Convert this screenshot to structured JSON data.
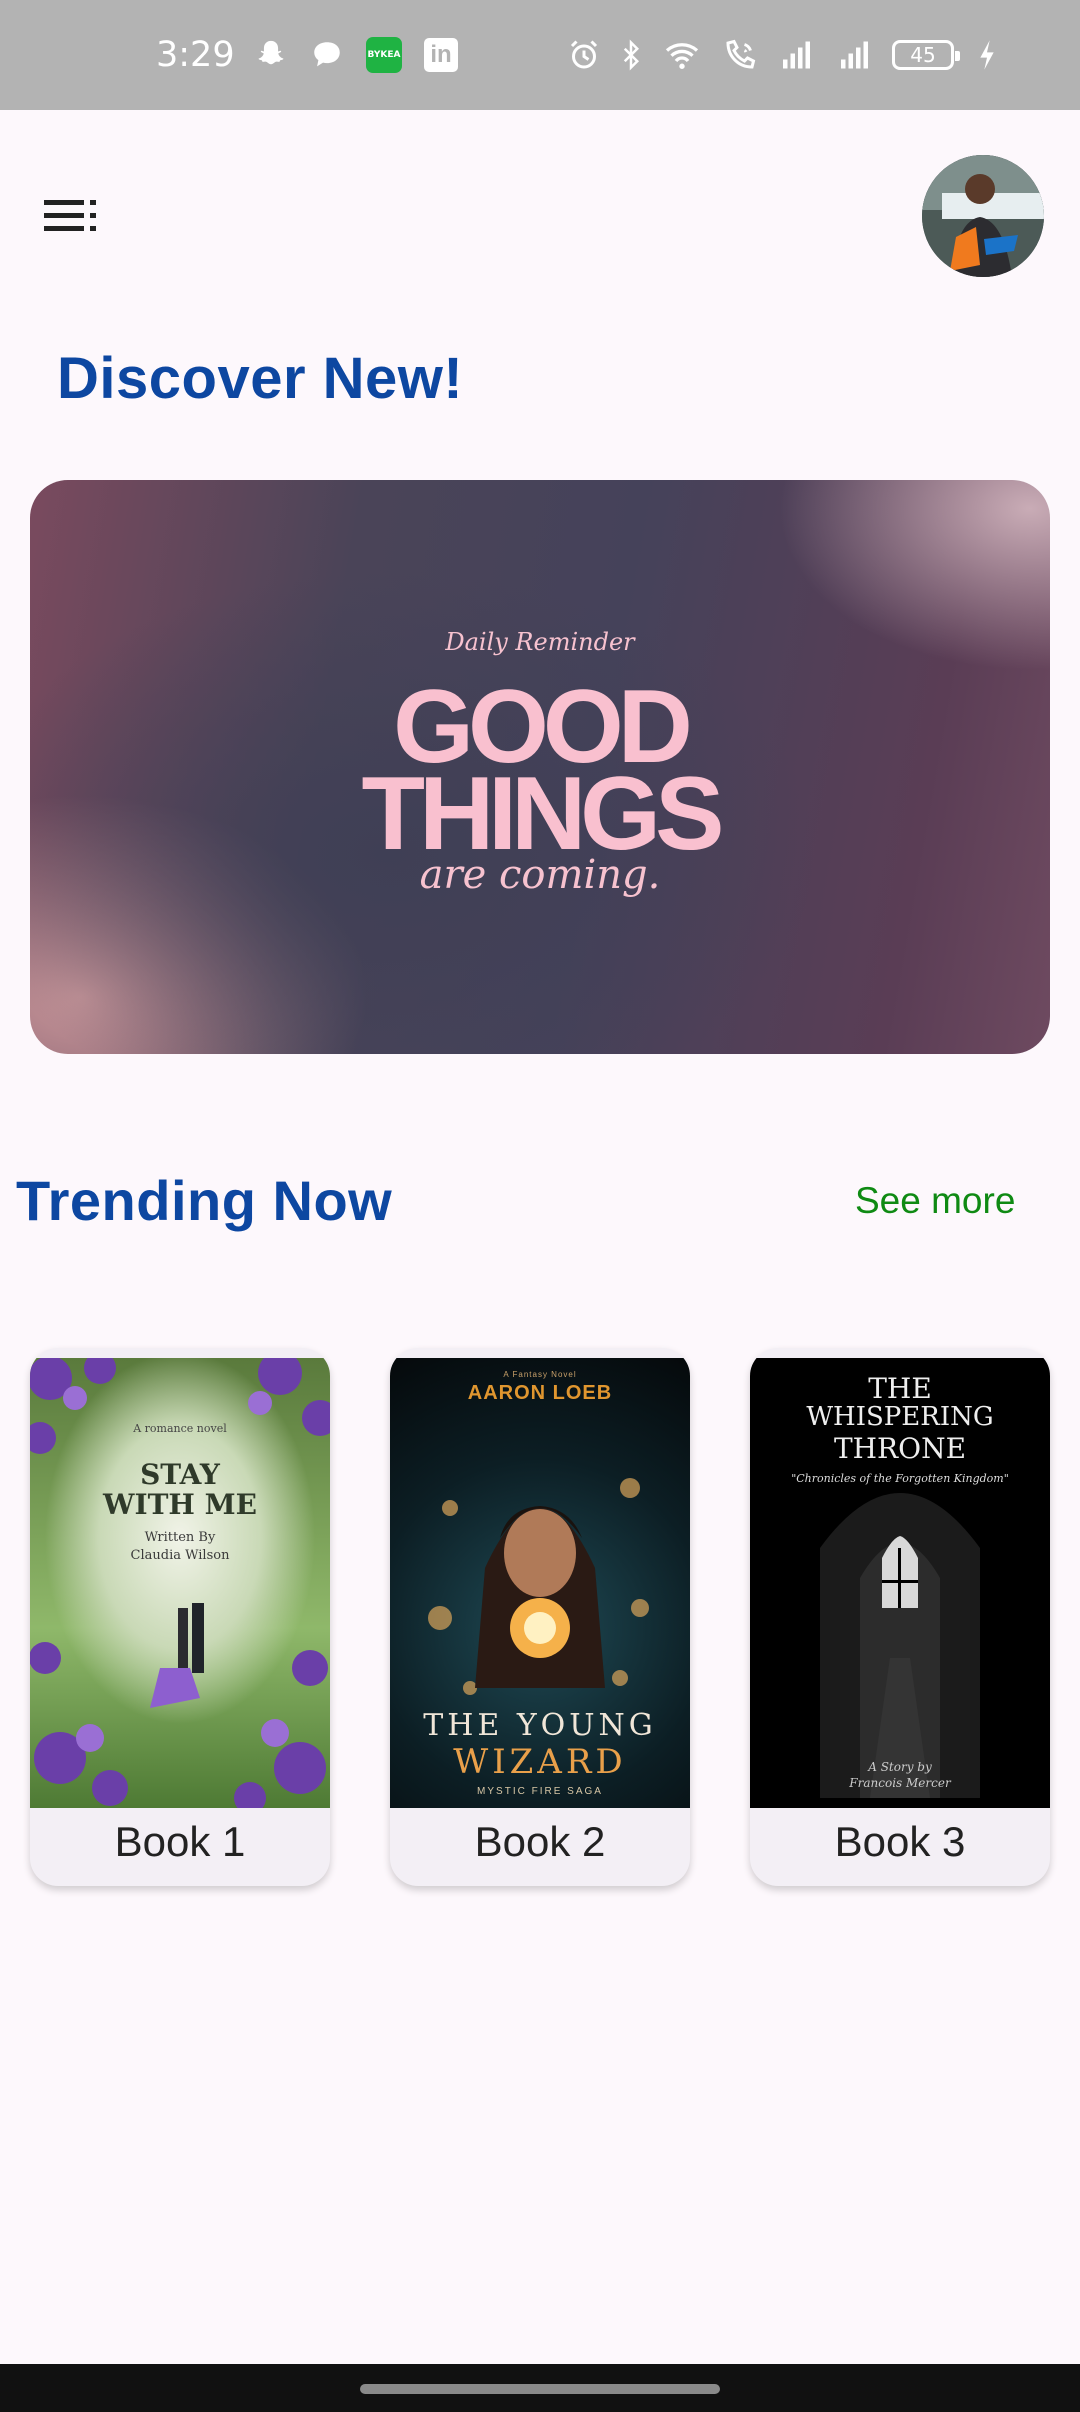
{
  "status_bar": {
    "time": "3:29",
    "app_badge": "BYKEA",
    "linkedin": "in",
    "battery": "45"
  },
  "header": {
    "menu_icon": "menu-icon",
    "avatar": "profile-avatar"
  },
  "discover": {
    "title": "Discover New!"
  },
  "banner": {
    "kicker": "Daily Reminder",
    "line1": "GOOD",
    "line2": "THINGS",
    "tail": "are coming."
  },
  "trending": {
    "title": "Trending Now",
    "see_more": "See more"
  },
  "books": [
    {
      "label": "Book 1",
      "cover_kicker": "A romance novel",
      "cover_title_1": "STAY",
      "cover_title_2": "WITH ME",
      "cover_byline_1": "Written By",
      "cover_byline_2": "Claudia Wilson"
    },
    {
      "label": "Book 2",
      "cover_kicker": "A Fantasy Novel",
      "cover_author": "AARON LOEB",
      "cover_title_1": "THE YOUNG",
      "cover_title_2": "WIZARD",
      "cover_series": "MYSTIC FIRE SAGA"
    },
    {
      "label": "Book 3",
      "cover_title_1": "THE",
      "cover_title_2": "WHISPERING",
      "cover_title_3": "THRONE",
      "cover_subtitle": "\"Chronicles of the Forgotten Kingdom\"",
      "cover_byline_1": "A Story by",
      "cover_byline_2": "Francois Mercer"
    }
  ],
  "colors": {
    "background": "#fdf8fc",
    "title_blue": "#0d47a1",
    "link_green": "#0f8a13",
    "banner_pink": "#f9c0cf"
  }
}
